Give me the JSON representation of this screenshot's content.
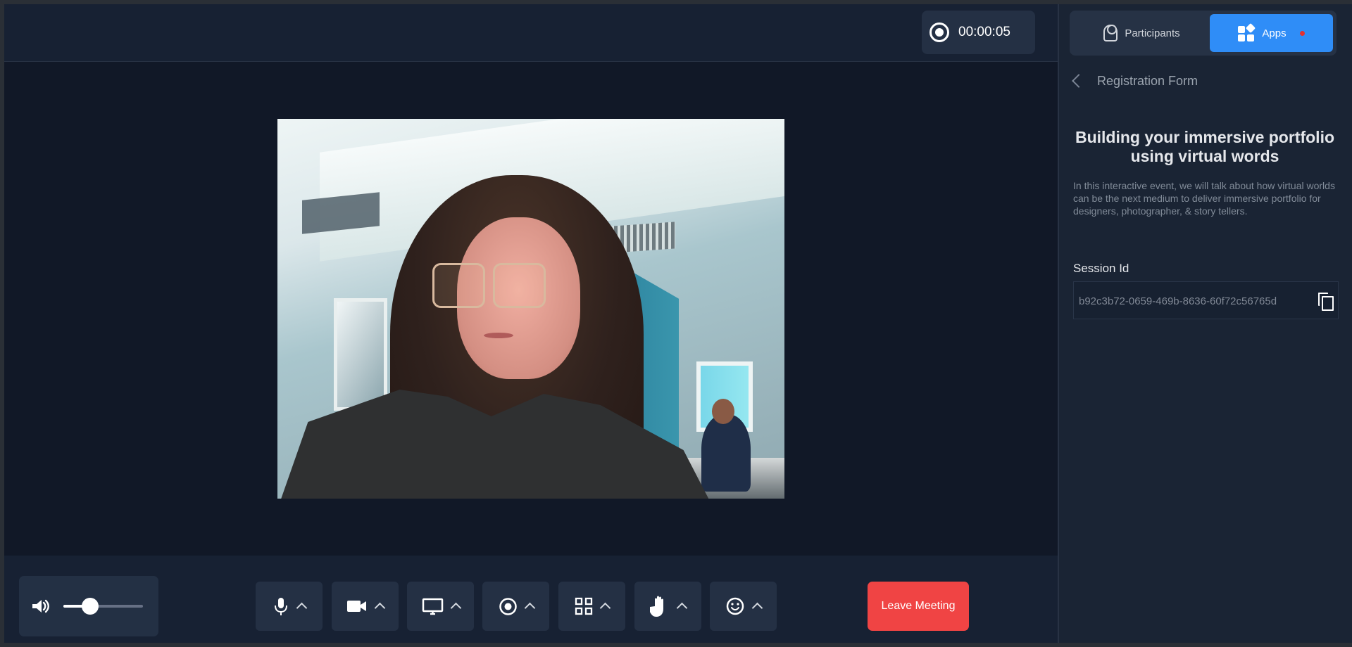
{
  "meeting": {
    "recording_time": "00:00:05",
    "leave_label": "Leave Meeting",
    "volume_percent": 34
  },
  "controls": [
    {
      "name": "microphone-control",
      "icon": "microphone-icon"
    },
    {
      "name": "camera-control",
      "icon": "video-camera-icon"
    },
    {
      "name": "screen-share-control",
      "icon": "monitor-icon"
    },
    {
      "name": "recording-control",
      "icon": "record-icon"
    },
    {
      "name": "layout-control",
      "icon": "grid-icon"
    },
    {
      "name": "raise-hand-control",
      "icon": "hand-icon"
    },
    {
      "name": "reactions-control",
      "icon": "smile-icon"
    }
  ],
  "sidebar": {
    "tabs": {
      "participants": "Participants",
      "apps": "Apps"
    },
    "breadcrumb": "Registration Form",
    "event_title": "Building your immersive portfolio using virtual words",
    "description": "In this interactive event, we will talk about how virtual worlds can be the next medium to deliver immersive portfolio for designers, photographer, & story tellers.",
    "session_label": "Session Id",
    "session_id": "b92c3b72-0659-469b-8636-60f72c56765d"
  },
  "colors": {
    "accent": "#2f8df7",
    "danger": "#f04444",
    "background": "#111827"
  }
}
